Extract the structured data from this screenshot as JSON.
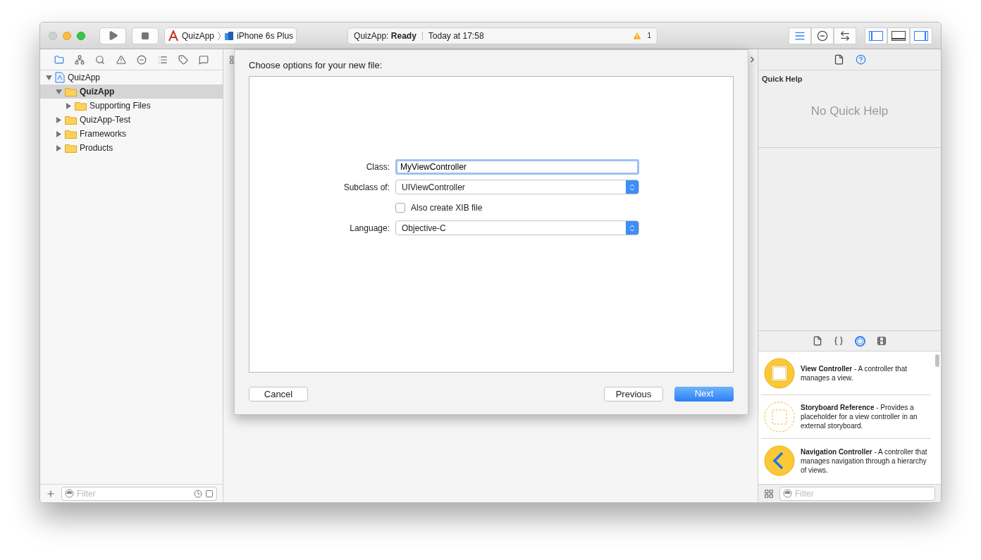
{
  "toolbar": {
    "scheme": {
      "app": "QuizApp",
      "device": "iPhone 6s Plus"
    },
    "status": {
      "project": "QuizApp:",
      "state": "Ready",
      "time": "Today at 17:58",
      "warnings": "1"
    },
    "editor_modes": [
      {
        "kind": "standard",
        "selected": true
      },
      {
        "kind": "assistant",
        "selected": false
      },
      {
        "kind": "version",
        "selected": false
      }
    ],
    "panels": [
      {
        "kind": "left",
        "on": true
      },
      {
        "kind": "bottom",
        "on": false
      },
      {
        "kind": "right",
        "on": true
      }
    ]
  },
  "navigator": {
    "tabs": [
      {
        "kind": "folder",
        "selected": true
      },
      {
        "kind": "hierarchy",
        "selected": false
      },
      {
        "kind": "search",
        "selected": false
      },
      {
        "kind": "warning",
        "selected": false
      },
      {
        "kind": "test",
        "selected": false
      },
      {
        "kind": "debug",
        "selected": false
      },
      {
        "kind": "breakpoint",
        "selected": false
      },
      {
        "kind": "report",
        "selected": false
      }
    ],
    "tree": [
      {
        "label": "QuizApp",
        "kind": "project",
        "expanded": true,
        "selected": false,
        "children": [
          {
            "label": "QuizApp",
            "kind": "folder",
            "expanded": true,
            "selected": true,
            "children": [
              {
                "label": "Supporting Files",
                "kind": "folder",
                "expanded": false,
                "selected": false
              }
            ]
          },
          {
            "label": "QuizApp-Test",
            "kind": "folder",
            "expanded": false,
            "selected": false
          },
          {
            "label": "Frameworks",
            "kind": "folder",
            "expanded": false,
            "selected": false
          },
          {
            "label": "Products",
            "kind": "folder",
            "expanded": false,
            "selected": false
          }
        ]
      }
    ],
    "filter": {
      "placeholder": "Filter"
    }
  },
  "dialog": {
    "title": "Choose options for your new file:",
    "fields": [
      {
        "kind": "text",
        "label": "Class:",
        "value": "MyViewController"
      },
      {
        "kind": "popup",
        "label": "Subclass of:",
        "value": "UIViewController"
      },
      {
        "kind": "checkbox",
        "label": "Also create XIB file",
        "checked": false
      },
      {
        "kind": "popup",
        "label": "Language:",
        "value": "Objective-C"
      }
    ],
    "buttons": [
      {
        "label": "Cancel",
        "kind": "plain"
      },
      {
        "label": "Previous",
        "kind": "plain"
      },
      {
        "label": "Next",
        "kind": "default"
      }
    ]
  },
  "inspector": {
    "tabs": [
      {
        "kind": "file",
        "selected": false
      },
      {
        "kind": "help",
        "selected": true
      }
    ],
    "title": "Quick Help",
    "message": "No Quick Help"
  },
  "library": {
    "tabs": [
      {
        "kind": "file",
        "selected": false
      },
      {
        "kind": "code",
        "selected": false
      },
      {
        "kind": "object",
        "selected": true
      },
      {
        "kind": "media",
        "selected": false
      }
    ],
    "items": [
      {
        "kind": "solid",
        "text": "**View Controller** - A controller that manages a view."
      },
      {
        "kind": "dashed",
        "text": "**Storyboard Reference** - Provides a placeholder for a view controller in an external storyboard."
      },
      {
        "kind": "navigation",
        "text": "**Navigation Controller** - A controller that manages navigation through a hierarchy of views."
      }
    ],
    "filter": {
      "placeholder": "Filter"
    }
  }
}
